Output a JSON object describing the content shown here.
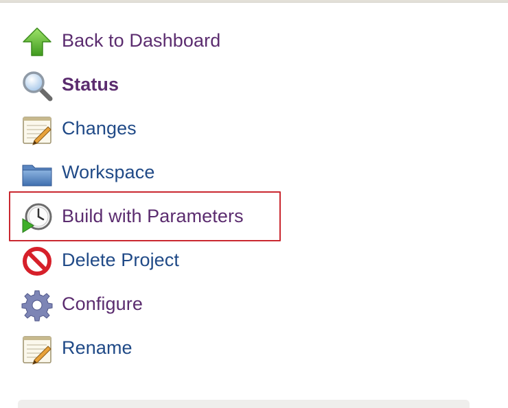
{
  "sidebar": {
    "items": [
      {
        "label": "Back to Dashboard",
        "icon": "up-arrow-icon"
      },
      {
        "label": "Status",
        "icon": "magnifier-icon"
      },
      {
        "label": "Changes",
        "icon": "notepad-icon"
      },
      {
        "label": "Workspace",
        "icon": "folder-icon"
      },
      {
        "label": "Build with Parameters",
        "icon": "clock-play-icon"
      },
      {
        "label": "Delete Project",
        "icon": "no-entry-icon"
      },
      {
        "label": "Configure",
        "icon": "gear-icon"
      },
      {
        "label": "Rename",
        "icon": "notepad-icon"
      }
    ]
  },
  "colors": {
    "visited_link": "#5b2c6f",
    "link": "#204a87",
    "highlight_border": "#c9272f"
  }
}
